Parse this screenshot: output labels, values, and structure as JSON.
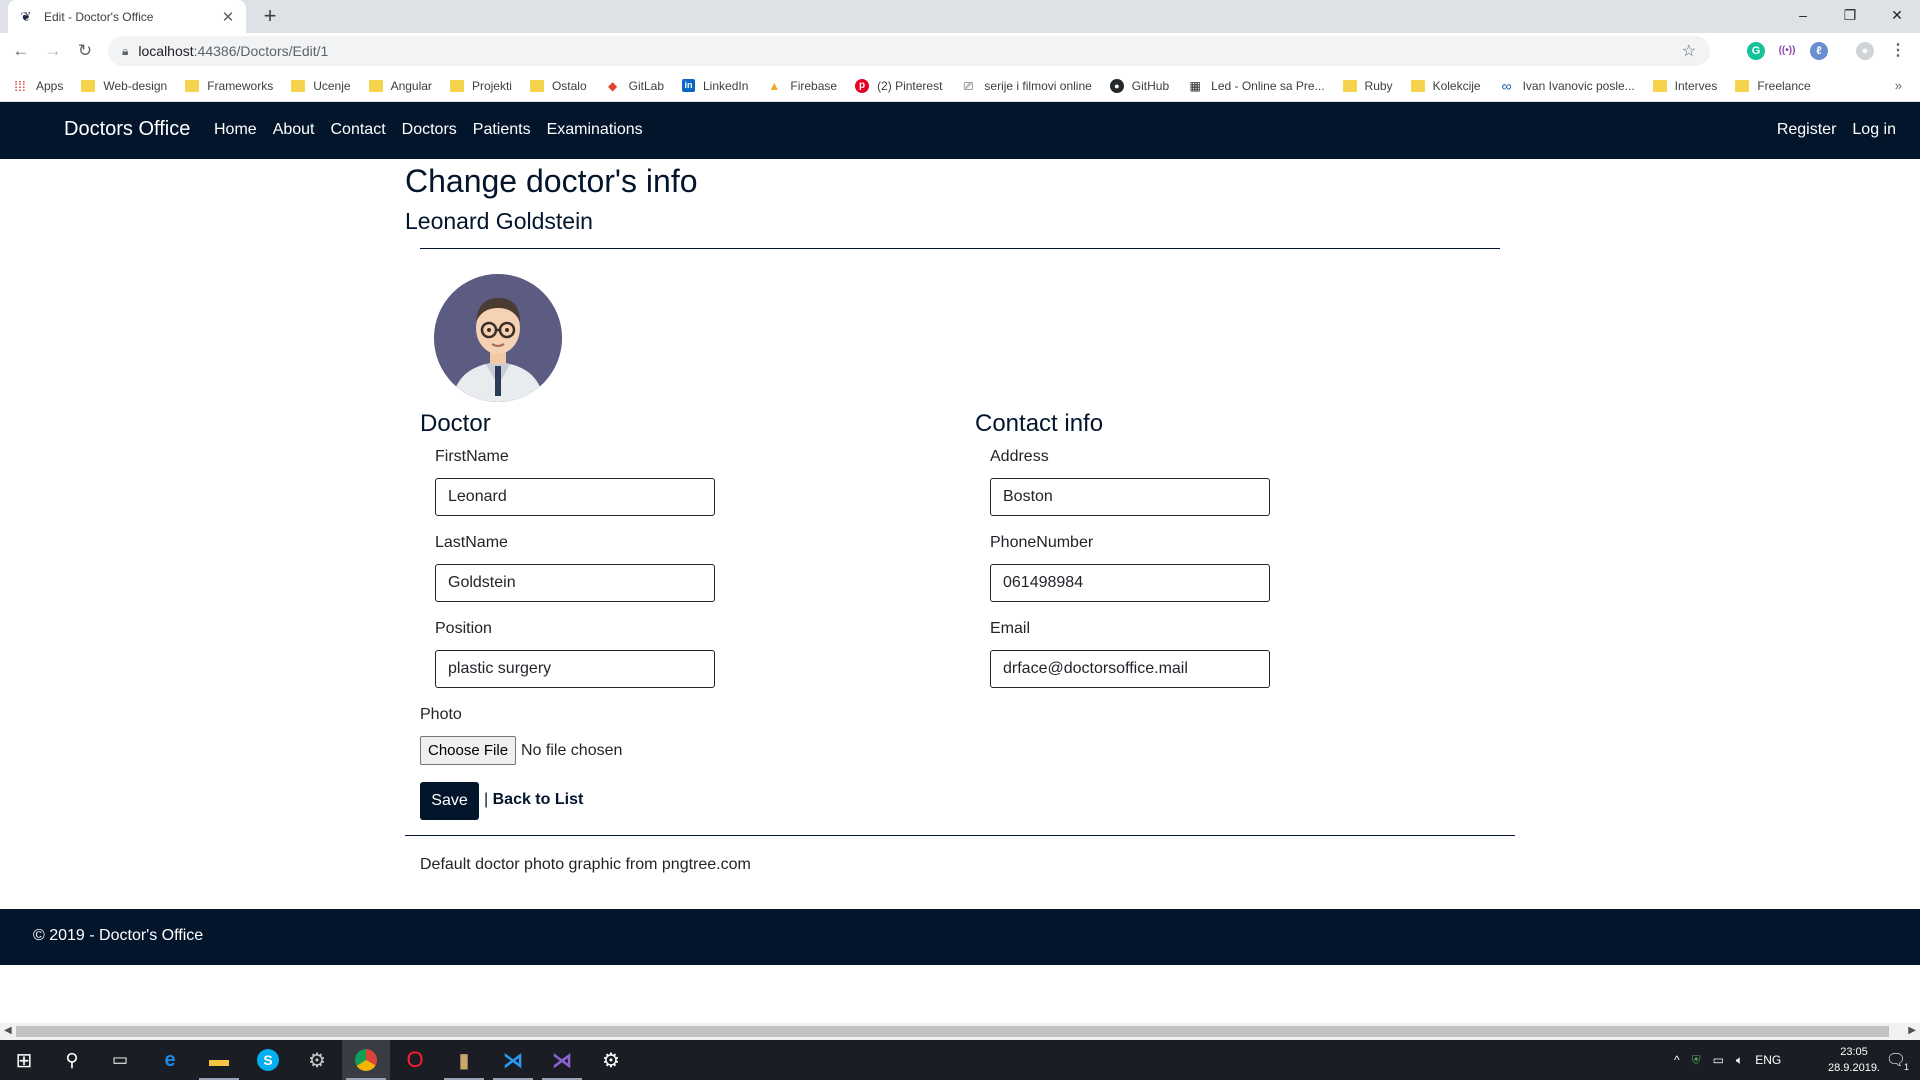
{
  "browser": {
    "tab_title": "Edit - Doctor's Office",
    "tab_close": "✕",
    "new_tab": "+",
    "url_host": "localhost",
    "url_path": ":44386/Doctors/Edit/1",
    "window_controls": [
      "–",
      "❐",
      "✕"
    ]
  },
  "bookmarks": [
    {
      "label": "Apps",
      "icon": "apps-grid-icon"
    },
    {
      "label": "Web-design",
      "icon": "folder-icon"
    },
    {
      "label": "Frameworks",
      "icon": "folder-icon"
    },
    {
      "label": "Ucenje",
      "icon": "folder-icon"
    },
    {
      "label": "Angular",
      "icon": "folder-icon"
    },
    {
      "label": "Projekti",
      "icon": "folder-icon"
    },
    {
      "label": "Ostalo",
      "icon": "folder-icon"
    },
    {
      "label": "GitLab",
      "icon": "gitlab-icon"
    },
    {
      "label": "LinkedIn",
      "icon": "linkedin-icon"
    },
    {
      "label": "Firebase",
      "icon": "firebase-icon"
    },
    {
      "label": "(2) Pinterest",
      "icon": "pinterest-icon"
    },
    {
      "label": "serije i filmovi online",
      "icon": "film-icon"
    },
    {
      "label": "GitHub",
      "icon": "github-icon"
    },
    {
      "label": "Led - Online sa Pre...",
      "icon": "film-strip-icon"
    },
    {
      "label": "Ruby",
      "icon": "folder-icon"
    },
    {
      "label": "Kolekcije",
      "icon": "folder-icon"
    },
    {
      "label": "Ivan Ivanovic posle...",
      "icon": "infinity-icon"
    },
    {
      "label": "Interves",
      "icon": "folder-icon"
    },
    {
      "label": "Freelance",
      "icon": "folder-icon"
    }
  ],
  "site": {
    "brand": "Doctors Office",
    "nav": [
      "Home",
      "About",
      "Contact",
      "Doctors",
      "Patients",
      "Examinations"
    ],
    "nav_right": [
      "Register",
      "Log in"
    ]
  },
  "page": {
    "title": "Change doctor's info",
    "subtitle": "Leonard Goldstein",
    "doctor_section": "Doctor",
    "contact_section": "Contact info",
    "fields": {
      "first_name": {
        "label": "FirstName",
        "value": "Leonard"
      },
      "last_name": {
        "label": "LastName",
        "value": "Goldstein"
      },
      "position": {
        "label": "Position",
        "value": "plastic surgery"
      },
      "address": {
        "label": "Address",
        "value": "Boston"
      },
      "phone": {
        "label": "PhoneNumber",
        "value": "061498984"
      },
      "email": {
        "label": "Email",
        "value": "drface@doctorsoffice.mail"
      }
    },
    "photo_label": "Photo",
    "choose_file": "Choose File",
    "file_status": "No file chosen",
    "save": "Save",
    "separator": "|",
    "back_to_list": "Back to List",
    "credit": "Default doctor photo graphic from pngtree.com"
  },
  "footer": {
    "text": "© 2019 - Doctor's Office"
  },
  "taskbar": {
    "language": "ENG",
    "time": "23:05",
    "date": "28.9.2019.",
    "notification_count": "1"
  },
  "colors": {
    "navbar": "#03152b",
    "accent": "#03152b",
    "avatar_bg": "#5c5b82"
  }
}
